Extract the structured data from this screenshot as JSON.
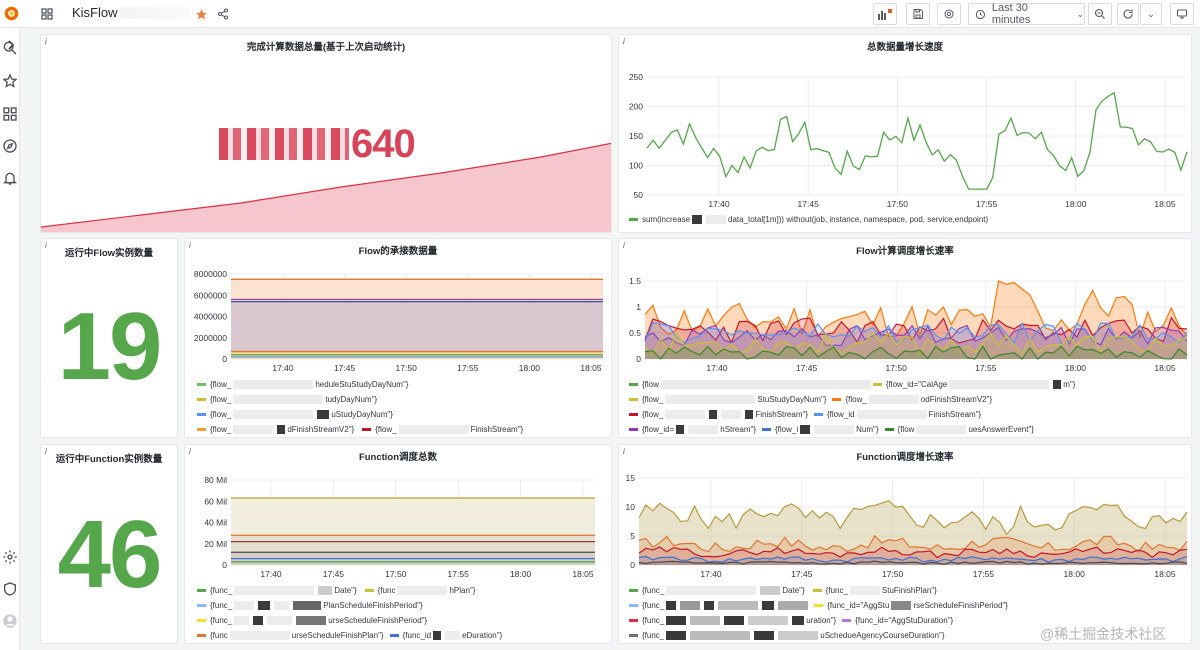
{
  "topbar": {
    "title": "KisFlow",
    "time_range": "Last 30 minutes"
  },
  "panels": {
    "total": {
      "title": "完成计算数据总量(基于上次启动统计)",
      "value_suffix": "640"
    },
    "rate": {
      "title": "总数据量增长速度",
      "y_ticks": [
        "250",
        "200",
        "150",
        "100",
        "50"
      ],
      "x_ticks": [
        "17:40",
        "17:45",
        "17:50",
        "17:55",
        "18:00",
        "18:05"
      ],
      "legend": [
        "sum(increase",
        "data_total[1m])) without(job, instance, namespace, pod, service,endpoint)"
      ]
    },
    "flow_count": {
      "title": "运行中Flow实例数量",
      "value": "19"
    },
    "flow_data": {
      "title": "Flow的承接数据量",
      "y_ticks": [
        "8000000",
        "6000000",
        "4000000",
        "2000000",
        "0"
      ],
      "x_ticks": [
        "17:40",
        "17:45",
        "17:50",
        "17:55",
        "18:00",
        "18:05"
      ],
      "legend": [
        [
          "{flow_",
          "heduleStuStudyDayNum\"}"
        ],
        [
          "{flow_",
          "tudyDayNum\"}"
        ],
        [
          "{flow_",
          "uStudyDayNum\"}"
        ],
        [
          "{flow_",
          "dFinishStreamV2\"}",
          "{flow_",
          "FinishStream\"}"
        ]
      ]
    },
    "flow_rate": {
      "title": "Flow计算调度增长速率",
      "y_ticks": [
        "1.5",
        "1",
        "0.5",
        "0"
      ],
      "x_ticks": [
        "17:40",
        "17:45",
        "17:50",
        "17:55",
        "18:00",
        "18:05"
      ],
      "legend": [
        [
          "{flow",
          "{flow_id=\"CalAge",
          "m\"}"
        ],
        [
          "{flow_",
          "StuStudyDayNum\"}",
          "{flow_",
          "odFinishStreamV2\"}"
        ],
        [
          "{flow_",
          "FinishStream\"}",
          "{flow_id",
          "FinishStream\"}"
        ],
        [
          "{flow_id=",
          "hStream\"}",
          "{flow_i",
          "Num\"}",
          "{flow",
          "uesAnswerEvent\"}"
        ]
      ]
    },
    "func_count": {
      "title": "运行中Function实例数量",
      "value": "46"
    },
    "func_total": {
      "title": "Function调度总数",
      "y_ticks": [
        "80 Mil",
        "60 Mil",
        "40 Mil",
        "20 Mil",
        "0"
      ],
      "x_ticks": [
        "17:40",
        "17:45",
        "17:50",
        "17:55",
        "18:00",
        "18:05"
      ],
      "legend": [
        [
          "{func_",
          "Date\"}",
          "{func",
          "hPlan\"}"
        ],
        [
          "{func_",
          "PlanScheduleFinishPeriod\"}"
        ],
        [
          "{func_",
          "urseScheduleFinishPeriod\"}"
        ],
        [
          "{func",
          "urseScheduleFinishPlan\"}",
          "{func_id",
          "eDuration\"}"
        ]
      ]
    },
    "func_rate": {
      "title": "Function调度增长速率",
      "y_ticks": [
        "15",
        "10",
        "5",
        "0"
      ],
      "x_ticks": [
        "17:40",
        "17:45",
        "17:50",
        "17:55",
        "18:00",
        "18:05"
      ],
      "legend": [
        [
          "{func_",
          "Date\"}",
          "{func_",
          "StuFinishPlan\"}"
        ],
        [
          "{func_",
          "{func_id=\"AggStu",
          "rseScheduleFinishPeriod\"}"
        ],
        [
          "{func_",
          "uration\"}",
          "{func_id=\"AggStuDuration\"}"
        ],
        [
          "{func_",
          "uSchedu",
          "eAgencyCourseDuration\"}"
        ]
      ]
    }
  },
  "watermark": "@稀土掘金技术社区",
  "colors": {
    "green": "#56a64b",
    "red": "#e02f44",
    "orange": "#ff780a",
    "accent": "#3d71d9"
  }
}
